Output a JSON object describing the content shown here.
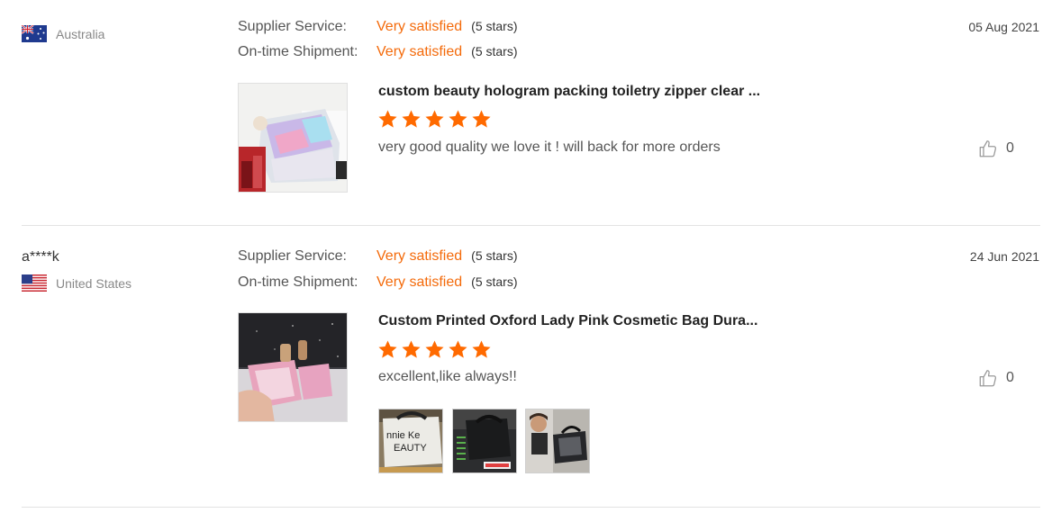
{
  "reviews": [
    {
      "buyer_name": "",
      "country": "Australia",
      "flag": "australia-flag",
      "date": "05 Aug 2021",
      "supplier_service": {
        "label": "Supplier Service:",
        "value": "Very satisfied",
        "stars": "(5 stars)"
      },
      "shipment": {
        "label": "On-time Shipment:",
        "value": "Very satisfied",
        "stars": "(5 stars)"
      },
      "product_title": "custom beauty hologram packing toiletry zipper clear ...",
      "product_rating": 5,
      "comment": "very good quality we love it ! will back for more orders",
      "likes": "0"
    },
    {
      "buyer_name": "a****k",
      "country": "United States",
      "flag": "usa-flag",
      "date": "24 Jun 2021",
      "supplier_service": {
        "label": "Supplier Service:",
        "value": "Very satisfied",
        "stars": "(5 stars)"
      },
      "shipment": {
        "label": "On-time Shipment:",
        "value": "Very satisfied",
        "stars": "(5 stars)"
      },
      "product_title": "Custom Printed Oxford Lady Pink Cosmetic Bag Dura...",
      "product_rating": 5,
      "comment": "excellent,like always!!",
      "likes": "0",
      "photo_text": [
        "nnie Ke",
        "EAUTY"
      ]
    }
  ],
  "colors": {
    "accent": "#f46a0a",
    "star": "#ff6a00",
    "divider": "#e3e3e3"
  },
  "icons": {
    "like": "thumbs-up-icon",
    "star": "star-icon"
  }
}
